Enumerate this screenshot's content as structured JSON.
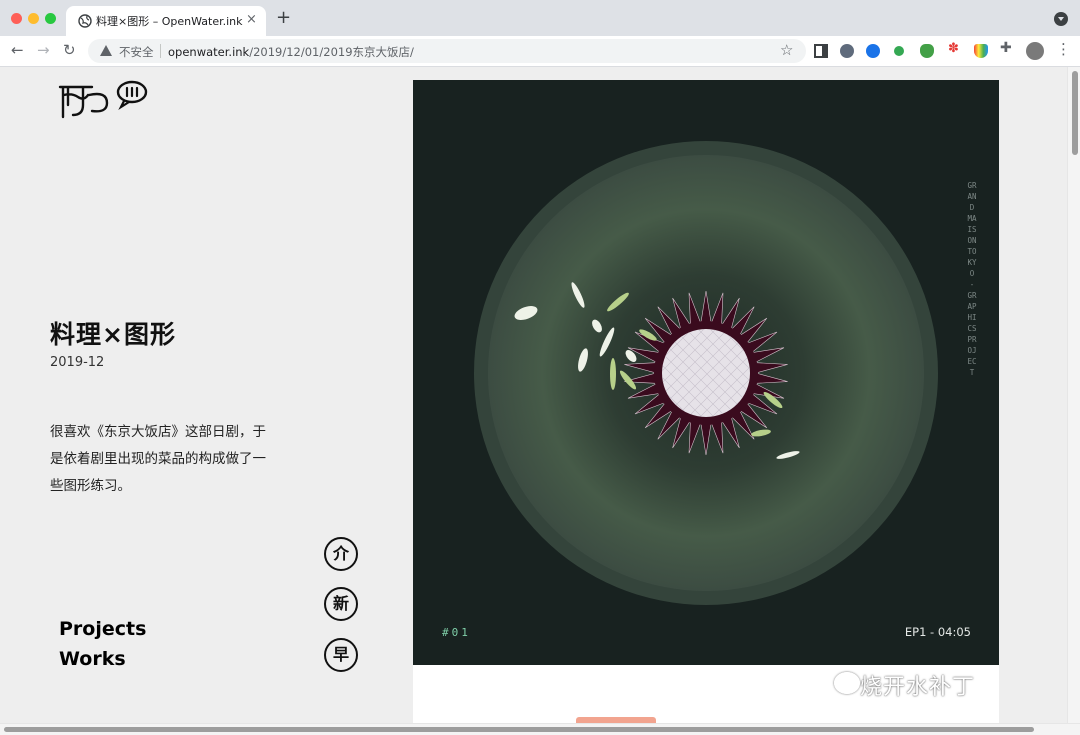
{
  "browser": {
    "tab_title": "料理×图形 – OpenWater.ink",
    "tab_close": "×",
    "new_tab": "+",
    "security_label": "不安全",
    "url_host": "openwater.ink",
    "url_path": "/2019/12/01/2019东京大饭店/",
    "icons": [
      "back-icon",
      "forward-icon",
      "reload-icon",
      "warning-icon",
      "star-icon",
      "side-panel-icon",
      "puzzle-icon",
      "menu-icon"
    ]
  },
  "post": {
    "title": "料理×图形",
    "date": "2019-12",
    "description": "很喜欢《东京大饭店》这部日剧，于是依着剧里出现的菜品的构成做了一些图形练习。"
  },
  "nav": {
    "projects": "Projects",
    "works": "Works",
    "circle_buttons": [
      "介",
      "新",
      "早"
    ]
  },
  "artwork": {
    "vertical_text": "GRAND MAISON TOKYO - GRAPHICS PROJECT",
    "episode_number": "#01",
    "episode_time": "EP1 - 04:05",
    "colors": {
      "background": "#182220",
      "plate_outer": "#3a4a40",
      "plate_inner": "#475c4a",
      "petals": "#3a0b1e",
      "center": "#e6e2e8",
      "leaves": "#b7d08a"
    }
  },
  "watermark": "烧开水补丁"
}
